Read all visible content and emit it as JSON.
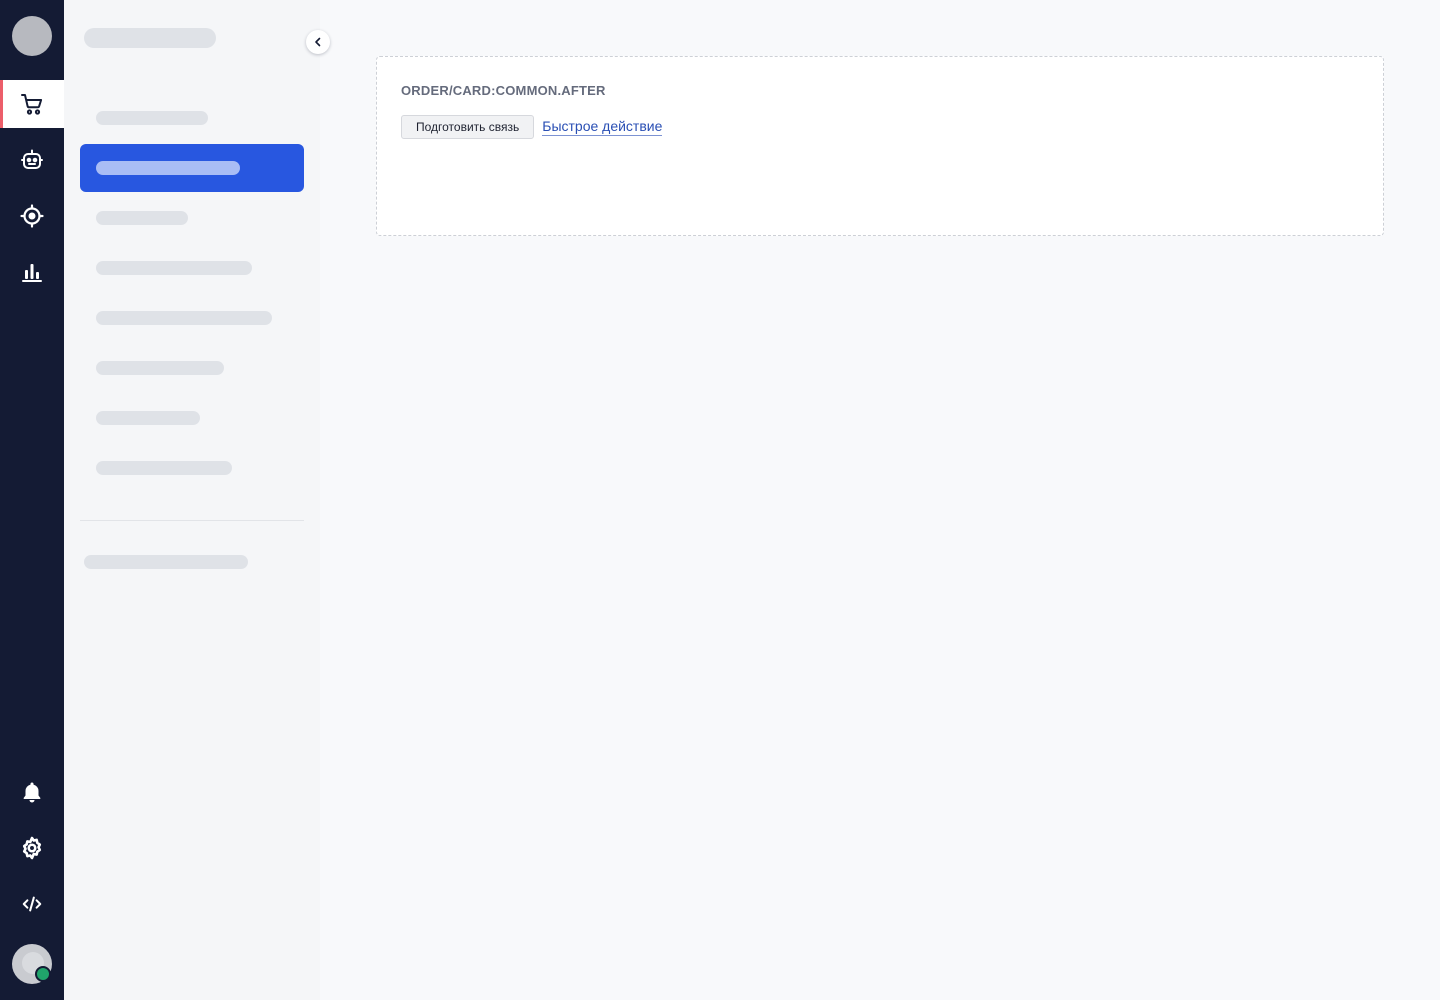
{
  "rail": {
    "items": [
      {
        "icon": "cart-icon",
        "active": true
      },
      {
        "icon": "robot-icon",
        "active": false
      },
      {
        "icon": "target-icon",
        "active": false
      },
      {
        "icon": "bar-chart-icon",
        "active": false
      }
    ],
    "bottom_items": [
      {
        "icon": "bell-icon"
      },
      {
        "icon": "gear-icon"
      },
      {
        "icon": "code-icon"
      }
    ],
    "avatar_status": "online"
  },
  "colors": {
    "rail_bg": "#141b34",
    "active_accent": "#ec5e6a",
    "nav_active": "#2857e0",
    "status_online": "#20a46b",
    "link": "#2a4fb4"
  },
  "main": {
    "card": {
      "title": "ORDER/CARD:COMMON.AFTER",
      "button_label": "Подготовить связь",
      "link_label": "Быстрое действие"
    }
  }
}
